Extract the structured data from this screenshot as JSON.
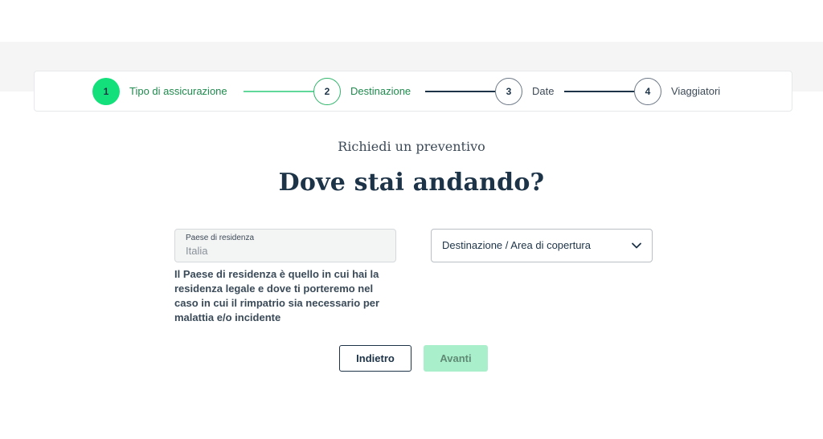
{
  "stepper": {
    "steps": [
      {
        "number": "1",
        "label": "Tipo di assicurazione"
      },
      {
        "number": "2",
        "label": "Destinazione"
      },
      {
        "number": "3",
        "label": "Date"
      },
      {
        "number": "4",
        "label": "Viaggiatori"
      }
    ]
  },
  "page": {
    "subtitle": "Richiedi un preventivo",
    "title": "Dove stai andando?"
  },
  "form": {
    "country": {
      "label": "Paese di residenza",
      "value": "Italia",
      "help": "Il Paese di residenza è quello in cui hai la residenza legale e dove ti porteremo nel caso in cui il rimpatrio sia necessario per malattia e/o incidente"
    },
    "destination": {
      "placeholder": "Destinazione / Area di copertura",
      "icon": "chevron-down-icon"
    }
  },
  "actions": {
    "back_label": "Indietro",
    "next_label": "Avanti"
  },
  "colors": {
    "accent": "#13e07a",
    "text_dark": "#1d3347",
    "step_green": "#1f8a4d",
    "disabled_button": "#a9efcb"
  }
}
